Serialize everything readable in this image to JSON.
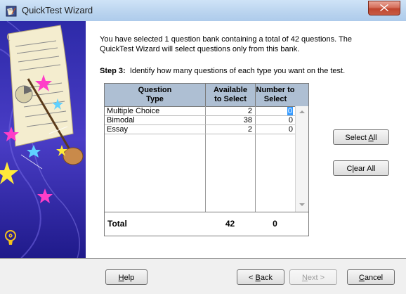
{
  "window": {
    "title": "QuickTest Wizard"
  },
  "intro": "You have selected 1 question bank containing a total of 42 questions.  The QuickTest Wizard will select questions only from this bank.",
  "step": {
    "label": "Step 3:",
    "text": "Identify how many questions of each type you want on the test."
  },
  "grid": {
    "headers": {
      "type_line1": "Question",
      "type_line2": "Type",
      "avail_line1": "Available",
      "avail_line2": "to Select",
      "num_line1": "Number to",
      "num_line2": "Select"
    },
    "rows": [
      {
        "type": "Multiple Choice",
        "available": "2",
        "number": "0"
      },
      {
        "type": "Bimodal",
        "available": "38",
        "number": "0"
      },
      {
        "type": "Essay",
        "available": "2",
        "number": "0"
      }
    ],
    "total": {
      "label": "Total",
      "available": "42",
      "number": "0"
    }
  },
  "buttons": {
    "select_all_pre": "Select ",
    "select_all_u": "A",
    "select_all_post": "ll",
    "clear_all_pre": "C",
    "clear_all_u": "l",
    "clear_all_post": "ear All",
    "help_u": "H",
    "help_post": "elp",
    "back_pre": "< ",
    "back_u": "B",
    "back_post": "ack",
    "next_u": "N",
    "next_post": "ext >",
    "cancel_u": "C",
    "cancel_post": "ancel"
  },
  "colors": {
    "accent": "#aebfd3",
    "selection": "#3399ff",
    "art_bg": "#3a2fb0"
  },
  "icons": [
    "app-icon",
    "close-icon",
    "scroll-up-icon",
    "scroll-down-icon"
  ]
}
